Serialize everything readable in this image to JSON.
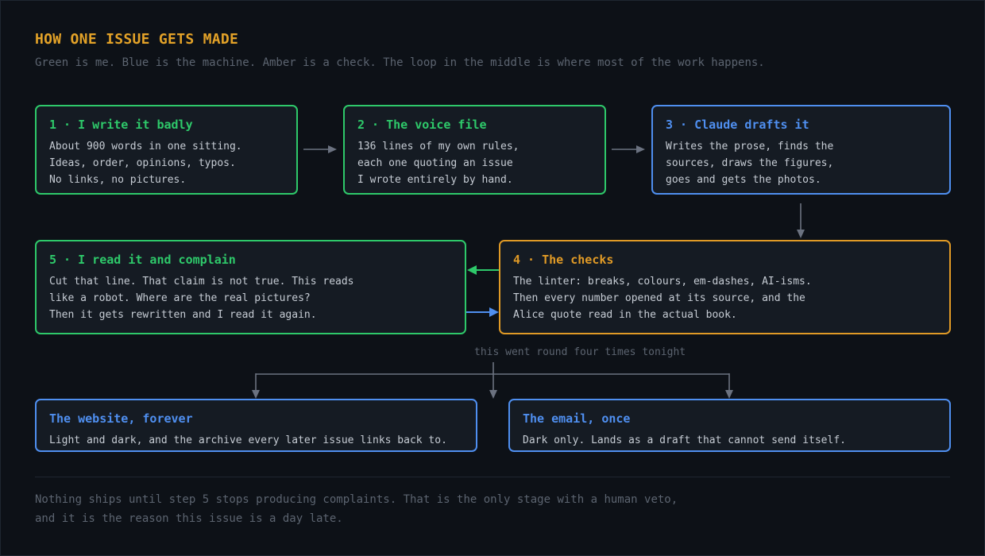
{
  "header": {
    "title": "HOW ONE ISSUE GETS MADE",
    "subtitle": "Green is me. Blue is the machine. Amber is a check. The loop in the middle is where most of the work happens."
  },
  "legend_colors": {
    "me": "#2ec96a",
    "machine": "#4f8ff0",
    "check": "#e09a26"
  },
  "steps": [
    {
      "title": "1 · I write it badly",
      "color": "green",
      "lines": [
        "About 900 words in one sitting.",
        "Ideas, order, opinions, typos.",
        "No links, no pictures."
      ]
    },
    {
      "title": "2 · The voice file",
      "color": "green",
      "lines": [
        "136 lines of my own rules,",
        "each one quoting an issue",
        "I wrote entirely by hand."
      ]
    },
    {
      "title": "3 · Claude drafts it",
      "color": "blue",
      "lines": [
        "Writes the prose, finds the",
        "sources, draws the figures,",
        "goes and gets the photos."
      ]
    },
    {
      "title": "4 · The checks",
      "color": "amber",
      "lines": [
        "The linter: breaks, colours, em-dashes, AI-isms.",
        "Then every number opened at its source, and the",
        "Alice quote read in the actual book."
      ]
    },
    {
      "title": "5 · I read it and complain",
      "color": "green",
      "lines": [
        "Cut that line. That claim is not true. This reads",
        "like a robot. Where are the real pictures?",
        "Then it gets rewritten and I read it again."
      ]
    }
  ],
  "loop_label": "this went round four times tonight",
  "outputs": [
    {
      "title": "The website, forever",
      "color": "blue",
      "text": "Light and dark, and the archive every later issue links back to."
    },
    {
      "title": "The email, once",
      "color": "blue",
      "text": "Dark only. Lands as a draft that cannot send itself."
    }
  ],
  "footer": {
    "lines": [
      "Nothing ships until step 5 stops producing complaints. That is the only stage with a human veto,",
      "and it is the reason this issue is a day late."
    ]
  }
}
